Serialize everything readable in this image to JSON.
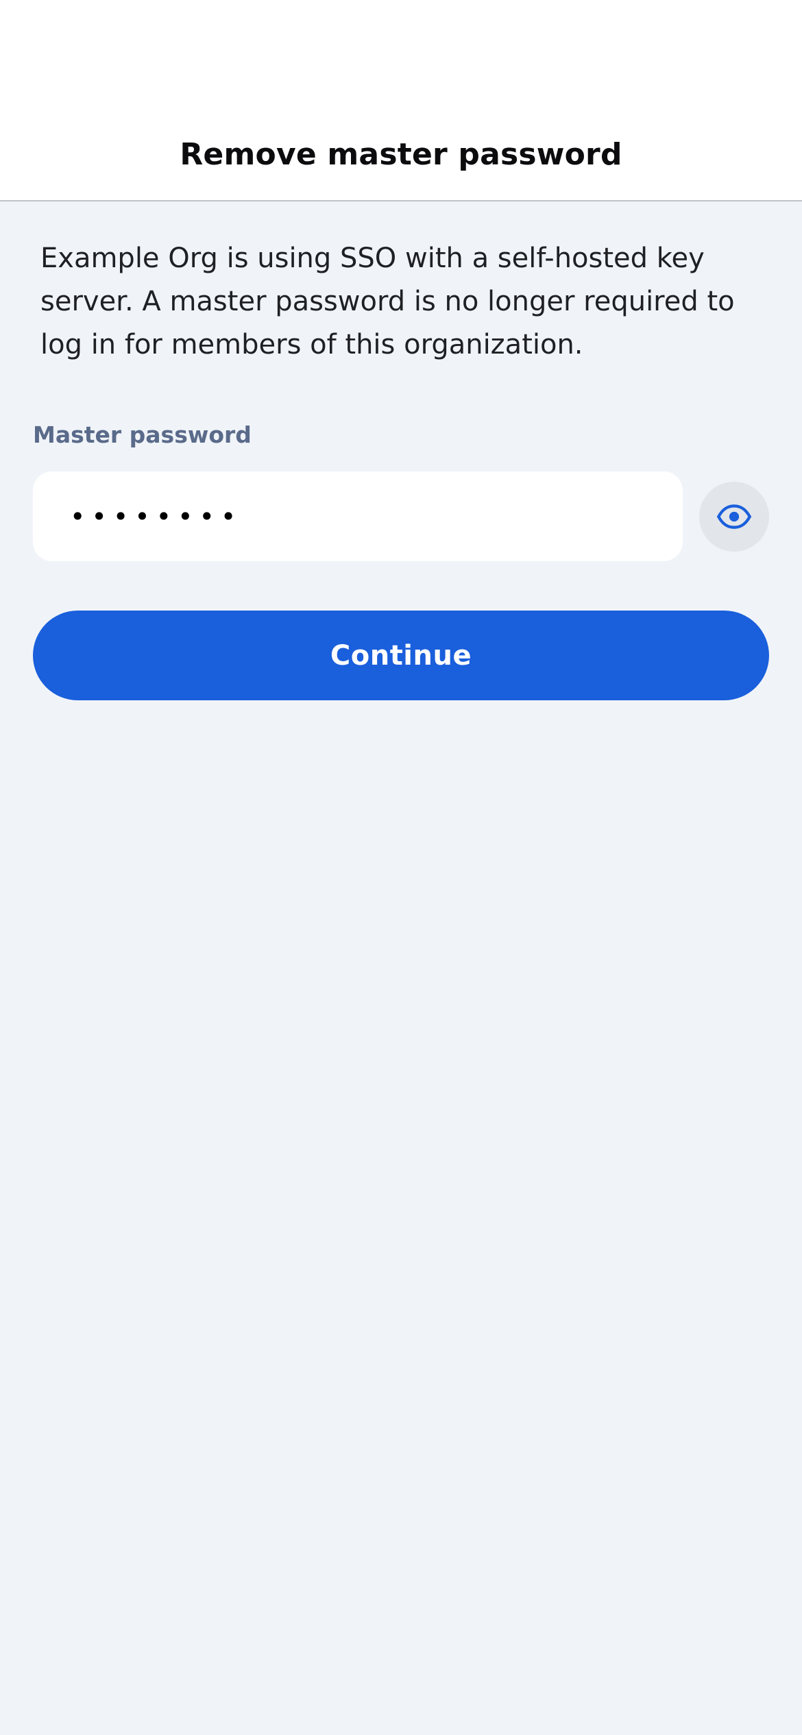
{
  "header": {
    "title": "Remove master password"
  },
  "main": {
    "description": "Example Org is using SSO with a self-hosted key server. A master password is no longer required to log in for members of this organization.",
    "password_field": {
      "label": "Master password",
      "masked_value": "••••••••",
      "toggle_icon": "eye-icon"
    },
    "continue_label": "Continue"
  },
  "colors": {
    "background": "#f0f4f8",
    "accent": "#1a5fdc",
    "label": "#5a6a8a"
  }
}
